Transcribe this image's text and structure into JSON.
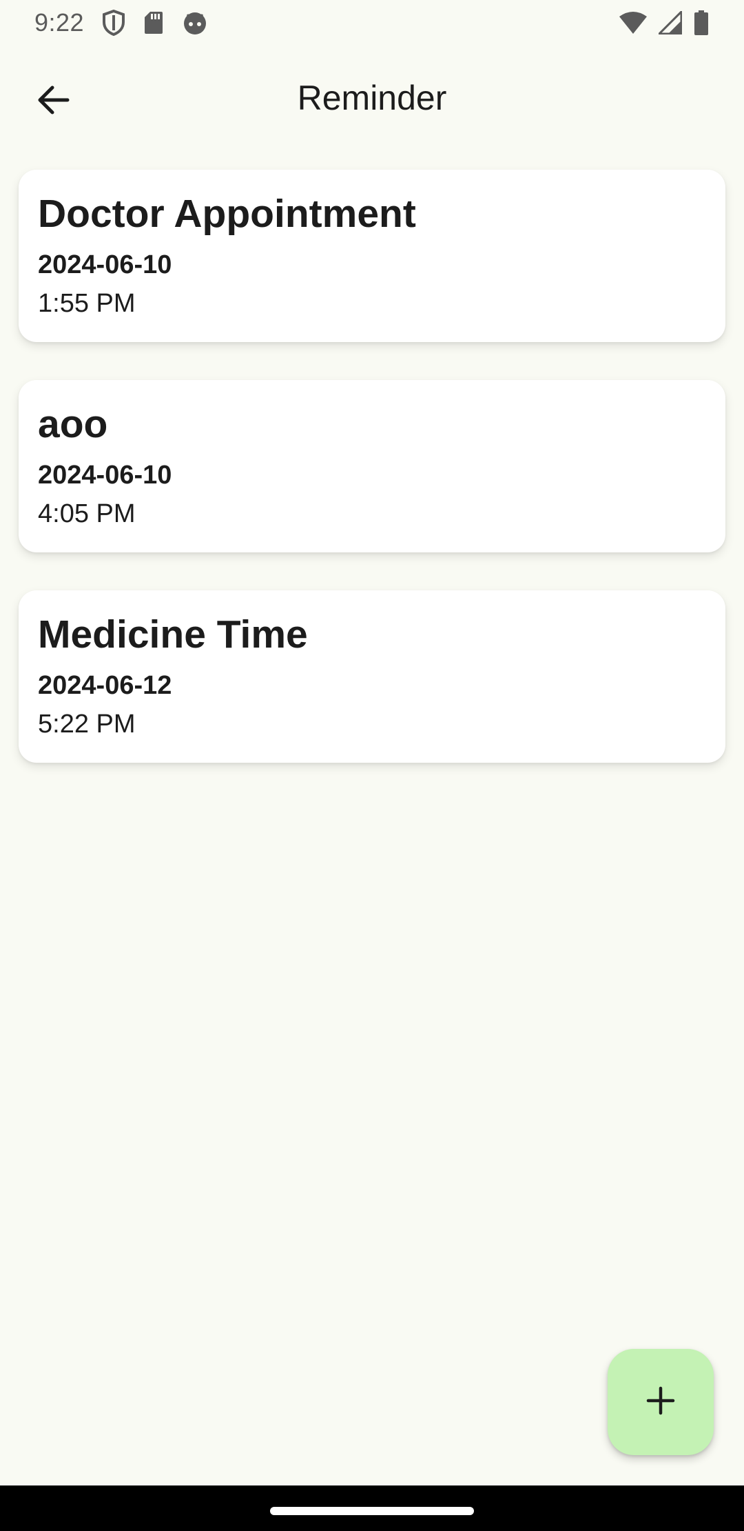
{
  "status_bar": {
    "time": "9:22",
    "left_icons": [
      "shield-icon",
      "sd-card-icon",
      "android-face-icon"
    ],
    "right_icons": [
      "wifi-icon",
      "signal-icon",
      "battery-icon"
    ]
  },
  "app_bar": {
    "title": "Reminder",
    "back_icon": "arrow-back-icon"
  },
  "reminders": [
    {
      "title": "Doctor Appointment",
      "date": "2024-06-10",
      "time": "1:55 PM"
    },
    {
      "title": "aoo",
      "date": "2024-06-10",
      "time": "4:05 PM"
    },
    {
      "title": "Medicine Time",
      "date": "2024-06-12",
      "time": "5:22 PM"
    }
  ],
  "fab": {
    "icon": "plus-icon"
  },
  "colors": {
    "background": "#F9FAF3",
    "card": "#FFFFFF",
    "fab": "#C4F2B4",
    "text": "#1C1C1C"
  }
}
